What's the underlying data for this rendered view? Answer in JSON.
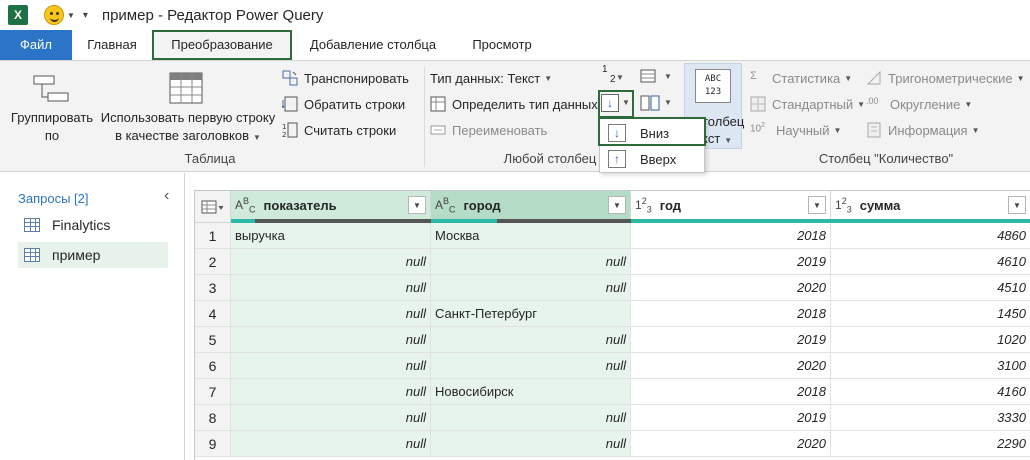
{
  "window": {
    "title": "пример - Редактор Power Query",
    "app_icon_letter": "X"
  },
  "tabs": [
    {
      "label": "Файл"
    },
    {
      "label": "Главная"
    },
    {
      "label": "Преобразование"
    },
    {
      "label": "Добавление столбца"
    },
    {
      "label": "Просмотр"
    }
  ],
  "ribbon": {
    "table_group": {
      "label": "Таблица",
      "group_by": "Группировать по",
      "group_by_l1": "Группировать",
      "group_by_l2": "по",
      "use_first_row_l1": "Использовать первую строку",
      "use_first_row_l2": "в качестве заголовков",
      "transpose": "Транспонировать",
      "reverse_rows": "Обратить строки",
      "count_rows": "Считать строки"
    },
    "any_column_group": {
      "label": "Любой столбец",
      "data_type": "Тип данных: Текст",
      "detect_type": "Определить тип данных",
      "rename": "Переименовать",
      "sort_icon_label_top": "1",
      "sort_icon_label_bottom": "2",
      "fill_dropdown_item_down": "Вниз",
      "fill_dropdown_item_up": "Вверх"
    },
    "text_column_group": {
      "icon_text_top": "ABC",
      "icon_text_bottom": "123",
      "label_l1": "толбец",
      "label_l2": "кст"
    },
    "number_column_group": {
      "label": "Столбец \"Количество\"",
      "statistics": "Статистика",
      "standard": "Стандартный",
      "scientific": "Научный",
      "scientific_prefix": "10",
      "scientific_sup": "2",
      "trigonometry": "Тригонометрические",
      "rounding": "Округление",
      "rounding_prefix": ".00",
      "information": "Информация"
    }
  },
  "queries": {
    "header": "Запросы [2]",
    "items": [
      {
        "label": "Finalytics"
      },
      {
        "label": "пример"
      }
    ]
  },
  "table": {
    "columns": [
      {
        "name": "показатель",
        "type_icon": "ABC",
        "type_top": "A",
        "type_sup": "B",
        "type_sub": "C"
      },
      {
        "name": "город",
        "type_icon": "ABC",
        "type_top": "A",
        "type_sup": "B",
        "type_sub": "C"
      },
      {
        "name": "год",
        "type_icon": "123",
        "type_top": "1",
        "type_sup": "2",
        "type_sub": "3"
      },
      {
        "name": "сумма",
        "type_icon": "123",
        "type_top": "1",
        "type_sup": "2",
        "type_sub": "3"
      }
    ],
    "rows": [
      {
        "n": "1",
        "c1": "выручка",
        "c2": "Москва",
        "c3": "2018",
        "c4": "4860"
      },
      {
        "n": "2",
        "c1": "null",
        "c2": "null",
        "c3": "2019",
        "c4": "4610"
      },
      {
        "n": "3",
        "c1": "null",
        "c2": "null",
        "c3": "2020",
        "c4": "4510"
      },
      {
        "n": "4",
        "c1": "null",
        "c2": "Санкт-Петербург",
        "c3": "2018",
        "c4": "1450"
      },
      {
        "n": "5",
        "c1": "null",
        "c2": "null",
        "c3": "2019",
        "c4": "1020"
      },
      {
        "n": "6",
        "c1": "null",
        "c2": "null",
        "c3": "2020",
        "c4": "3100"
      },
      {
        "n": "7",
        "c1": "null",
        "c2": "Новосибирск",
        "c3": "2018",
        "c4": "4160"
      },
      {
        "n": "8",
        "c1": "null",
        "c2": "null",
        "c3": "2019",
        "c4": "3330"
      },
      {
        "n": "9",
        "c1": "null",
        "c2": "null",
        "c3": "2020",
        "c4": "2290"
      }
    ]
  },
  "colors": {
    "file_tab": "#2b74c7",
    "highlight_box": "#2e6b3a",
    "selected_column_bg": "#e6f4ec",
    "quality_bar_full": "#2db8a8"
  }
}
